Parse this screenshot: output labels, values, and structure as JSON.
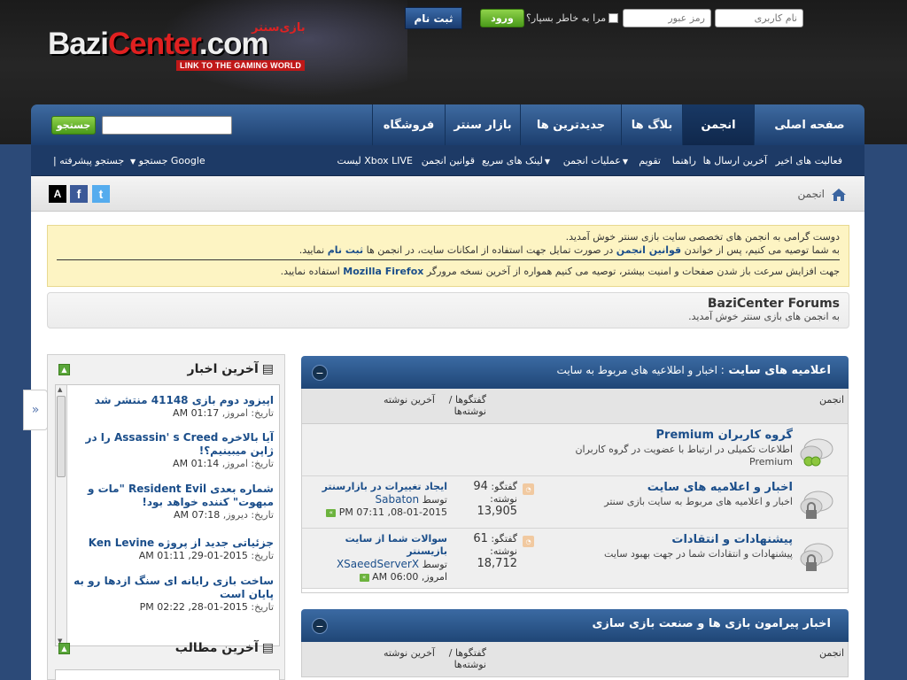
{
  "header": {
    "logo_main_a": "Bazi",
    "logo_main_b": "Center",
    "logo_main_c": ".com",
    "logo_arabic": "بازی‌سنتر",
    "logo_tagline": "LINK TO THE GAMING WORLD"
  },
  "login": {
    "username_placeholder": "نام کاربری",
    "password_placeholder": "رمز عبور",
    "remember_label": "مرا به خاطر بسپار؟",
    "login_label": "ورود",
    "register_label": "ثبت نام"
  },
  "nav": {
    "tabs": [
      "صفحه اصلی",
      "انجمن",
      "بلاگ ها",
      "جدیدترین ها",
      "بازار سنتر",
      "فروشگاه"
    ],
    "active_tab": "انجمن",
    "search_button": "جستجو"
  },
  "subnav": {
    "items": [
      "فعالیت های اخیر",
      "آخرین ارسال ها",
      "راهنما",
      "تقویم",
      "عملیات انجمن",
      "لینک های سریع",
      "قوانین انجمن",
      "لیست Xbox LIVE"
    ],
    "google_search": "جستجو Google",
    "advanced_search": "| جستجو پیشرفته"
  },
  "breadcrumb": {
    "label": "انجمن"
  },
  "share": {
    "a_label": "A",
    "fb_label": "f",
    "tw_label": "t"
  },
  "notice": {
    "line1": "دوست گرامی به انجمن های تخصصی سایت بازی سنتر خوش آمدید.",
    "line2_a": "به شما توصیه می کنیم، پس از خواندن ",
    "line2_link1": "قوانین انجمن",
    "line2_b": " در صورت تمایل جهت استفاده از امکانات سایت، در انجمن ها ",
    "line2_link2": "ثبت نام",
    "line2_c": " نمایید.",
    "line3_a": "جهت افزایش سرعت باز شدن صفحات و امنیت بیشتر، توصیه می کنیم همواره از آخرین نسخه مرورگر ",
    "line3_link": "Mozilla Firefox",
    "line3_b": " استفاده نمایید."
  },
  "forum_title": {
    "title": "BaziCenter Forums",
    "subtitle": "به انجمن های بازی سنتر خوش آمدید."
  },
  "sidebar": {
    "news_title": "آخرین اخبار",
    "news": [
      {
        "title": "اپیزود دوم بازی 41148 منتشر شد",
        "date_prefix": "تاریخ: امروز,",
        "date": "01:17 AM"
      },
      {
        "title": "آیا بالاخره Assassin' s Creed را در ژاپن میبینیم؟!",
        "date_prefix": "تاریخ: امروز,",
        "date": "01:14 AM"
      },
      {
        "title": "شماره بعدی Resident Evil \"مات و مبهوت\" کننده خواهد بود!",
        "date_prefix": "تاریخ: دیروز,",
        "date": "07:18 AM"
      },
      {
        "title": "جزئیاتی جدید از پروژه Ken Levine",
        "date_prefix": "تاریخ:",
        "date": "2015-01-29, 01:11 AM"
      },
      {
        "title": "ساخت بازی رایانه ای سنگ ازدها رو به پایان است",
        "date_prefix": "تاریخ:",
        "date": "2015-01-28, 02:22 PM"
      }
    ],
    "recent_title": "آخرین مطالب"
  },
  "categories": [
    {
      "title": "اعلامیه های سایت",
      "subtitle": ": اخبار و اطلاعیه های مربوط به سایت",
      "col_forum": "انجمن",
      "col_stats": "گفتگوها / نوشته‌ها",
      "col_last": "آخرین نوشته",
      "forums": [
        {
          "name": "گروه کاربران Premium",
          "desc": "اطلاعات تکمیلی در ارتباط با عضویت در گروه کاربران Premium"
        },
        {
          "name": "اخبار و اعلامیه های سایت",
          "desc": "اخبار و اعلامیه های مربوط به سایت بازی سنتر",
          "threads_label": "گفتگو:",
          "threads": "94",
          "posts_label": "نوشته:",
          "posts": "13,905",
          "last_title": "ایجاد تغییرات در بازارسنتر",
          "last_by": "توسط",
          "last_user": "Sabaton",
          "last_date": "08-01-2015, 07:11 PM"
        },
        {
          "name": "پیشنهادات و انتقادات",
          "desc": "پیشنهادات و انتقادات شما در جهت بهبود سایت",
          "threads_label": "گفتگو:",
          "threads": "61",
          "posts_label": "نوشته:",
          "posts": "18,712",
          "last_title": "سوالات شما از سایت بازیسنتر",
          "last_by": "توسط",
          "last_user": "XSaeedServerX",
          "last_date": "امروز, 06:00 AM"
        }
      ]
    },
    {
      "title": "اخبار پیرامون بازی ها و صنعت بازی سازی",
      "col_forum": "انجمن",
      "col_stats": "گفتگوها / نوشته‌ها",
      "col_last": "آخرین نوشته"
    }
  ],
  "colors": {
    "nav_blue": "#2c5a92",
    "link_blue": "#1b4e8a",
    "notice_bg": "#fdf4c3",
    "green_button": "#5aa63a",
    "register_blue": "#1f4676"
  }
}
